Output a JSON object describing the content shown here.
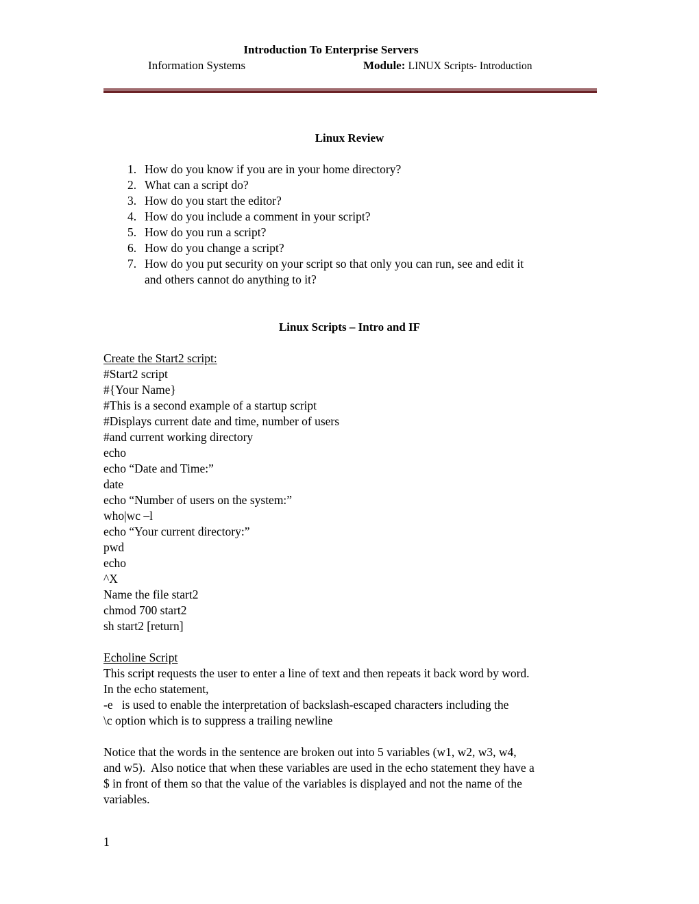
{
  "header": {
    "title": "Introduction To Enterprise Servers",
    "department": "Information Systems",
    "module_label": "Module:",
    "module_value": "LINUX Scripts- Introduction",
    "rule_color": "#6b2226"
  },
  "review": {
    "heading": "Linux Review",
    "questions": [
      {
        "num": "1.",
        "lines": [
          "How do you know if you are in your home directory?"
        ]
      },
      {
        "num": "2.",
        "lines": [
          "What can a script do?"
        ]
      },
      {
        "num": "3.",
        "lines": [
          "How do you start the editor?"
        ]
      },
      {
        "num": "4.",
        "lines": [
          "How do you include a comment in your script?"
        ]
      },
      {
        "num": "5.",
        "lines": [
          "How do you run a script?"
        ]
      },
      {
        "num": "6.",
        "lines": [
          "How do you change a script?"
        ]
      },
      {
        "num": "7.",
        "lines": [
          "How do you put security on your script so that only you can run, see and edit it",
          "and others cannot do anything to it?"
        ]
      }
    ]
  },
  "scripts": {
    "heading": "Linux Scripts – Intro and IF",
    "start2": {
      "title": "Create the Start2 script:",
      "lines": [
        "#Start2 script",
        "#{Your Name}",
        "#This is a second example of a startup script",
        "#Displays current date and time, number of users",
        "#and current working directory",
        "echo",
        "echo “Date and Time:”",
        "date",
        "echo “Number of users on the system:”",
        "who|wc –l",
        "echo “Your current directory:”",
        "pwd",
        "echo",
        "^X",
        "Name the file start2",
        "chmod 700 start2",
        "sh start2 [return]"
      ]
    },
    "echoline": {
      "title": "Echoline Script",
      "lines": [
        "This script requests the user to enter a line of text and then repeats it back word by word.",
        "In the echo statement,",
        "-e   is used to enable the interpretation of backslash-escaped characters including the",
        "\\c option which is to suppress a trailing newline"
      ]
    },
    "notice": {
      "lines": [
        "Notice that the words in the sentence are broken out into 5 variables (w1, w2, w3, w4,",
        "and w5).  Also notice that when these variables are used in the echo statement they have a",
        "$ in front of them so that the value of the variables is displayed and not the name of the",
        "variables."
      ]
    }
  },
  "footer": {
    "page_number": "1"
  }
}
